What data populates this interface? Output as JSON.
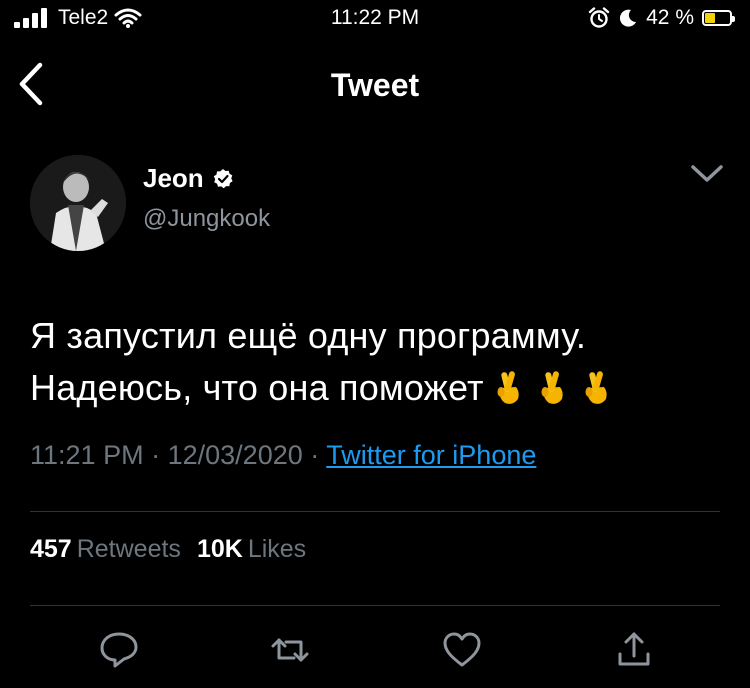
{
  "status_bar": {
    "carrier": "Tele2",
    "time": "11:22 PM",
    "battery_percent": "42 %",
    "battery_level": 0.42,
    "icons": [
      "signal-icon",
      "wifi-icon",
      "alarm-icon",
      "moon-icon",
      "battery-charging-icon"
    ]
  },
  "nav": {
    "title": "Tweet",
    "back_icon": "chevron-left-icon"
  },
  "author": {
    "name": "Jeon",
    "handle": "@Jungkook",
    "verified_icon": "verified-badge-icon",
    "menu_icon": "chevron-down-icon"
  },
  "tweet": {
    "line1": "Я запустил ещё одну программу.",
    "line2": "Надеюсь, что она поможет",
    "emojis": [
      "crossed-fingers",
      "crossed-fingers",
      "crossed-fingers"
    ]
  },
  "meta": {
    "time": "11:21 PM",
    "separator": "·",
    "date": "12/03/2020",
    "source": "Twitter for iPhone"
  },
  "stats": {
    "retweets_count": "457",
    "retweets_label": "Retweets",
    "likes_count": "10K",
    "likes_label": "Likes"
  },
  "actions": [
    "reply-icon",
    "retweet-icon",
    "like-icon",
    "share-icon"
  ],
  "colors": {
    "background": "#000000",
    "secondary_text": "#6e767d",
    "link": "#1d9bf0",
    "battery": "#f2d20b"
  }
}
